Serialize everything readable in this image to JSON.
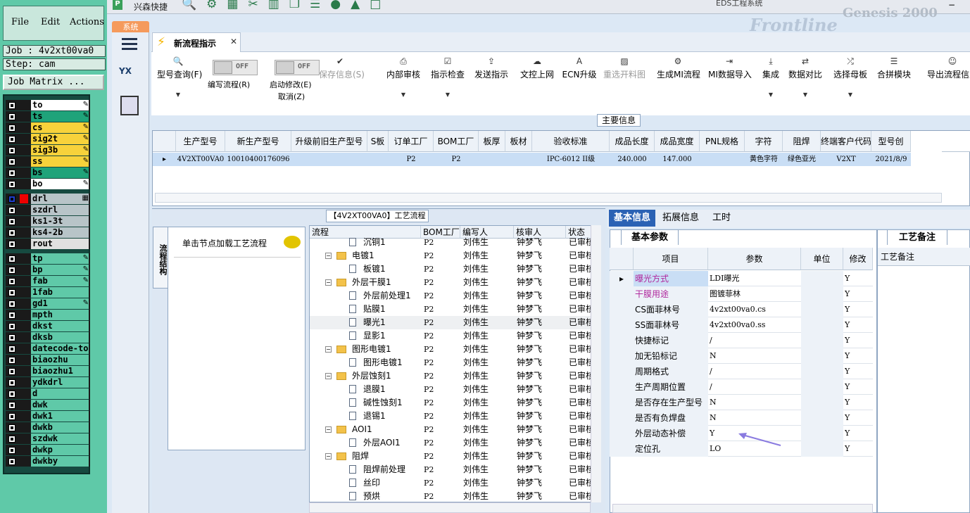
{
  "genesis": {
    "menu": {
      "file": "File",
      "edit": "Edit",
      "actions": "Actions"
    },
    "job": "Job : 4v2xt00va0",
    "step": "Step: cam",
    "job_matrix": "Job Matrix ...",
    "layers": [
      {
        "name": "to",
        "color": "#ffffff",
        "icon": "edit-icon"
      },
      {
        "name": "ts",
        "color": "#1fa37a",
        "icon": "edit-icon"
      },
      {
        "name": "cs",
        "color": "#f7d23b",
        "icon": "edit-icon"
      },
      {
        "name": "sig2t",
        "color": "#f7d23b",
        "icon": "edit-icon"
      },
      {
        "name": "sig3b",
        "color": "#f7d23b",
        "icon": "edit-icon"
      },
      {
        "name": "ss",
        "color": "#f7d23b",
        "icon": "edit-icon"
      },
      {
        "name": "bs",
        "color": "#1fa37a",
        "icon": "edit-icon"
      },
      {
        "name": "bo",
        "color": "#ffffff",
        "icon": "edit-icon"
      },
      {
        "name": "drl",
        "color": "#b8c4c8",
        "icon": "grid-icon"
      },
      {
        "name": "szdrl",
        "color": "#b8c4c8",
        "icon": ""
      },
      {
        "name": "ks1-3t",
        "color": "#b8c4c8",
        "icon": ""
      },
      {
        "name": "ks4-2b",
        "color": "#b8c4c8",
        "icon": ""
      },
      {
        "name": "rout",
        "color": "#e0e0e0",
        "icon": ""
      },
      {
        "name": "tp",
        "color": "#5fc9a8",
        "icon": "edit-icon"
      },
      {
        "name": "bp",
        "color": "#5fc9a8",
        "icon": "edit-icon"
      },
      {
        "name": "fab",
        "color": "#5fc9a8",
        "icon": "edit-icon"
      },
      {
        "name": "1fab",
        "color": "#5fc9a8",
        "icon": ""
      },
      {
        "name": "gd1",
        "color": "#5fc9a8",
        "icon": "edit-icon"
      },
      {
        "name": "mpth",
        "color": "#5fc9a8",
        "icon": ""
      },
      {
        "name": "dkst",
        "color": "#5fc9a8",
        "icon": ""
      },
      {
        "name": "dksb",
        "color": "#5fc9a8",
        "icon": ""
      },
      {
        "name": "datecode-to",
        "color": "#5fc9a8",
        "icon": ""
      },
      {
        "name": "biaozhu",
        "color": "#5fc9a8",
        "icon": ""
      },
      {
        "name": "biaozhu1",
        "color": "#5fc9a8",
        "icon": ""
      },
      {
        "name": "ydkdrl",
        "color": "#5fc9a8",
        "icon": ""
      },
      {
        "name": "d",
        "color": "#5fc9a8",
        "icon": ""
      },
      {
        "name": "dwk",
        "color": "#5fc9a8",
        "icon": ""
      },
      {
        "name": "dwk1",
        "color": "#5fc9a8",
        "icon": ""
      },
      {
        "name": "dwkb",
        "color": "#5fc9a8",
        "icon": ""
      },
      {
        "name": "szdwk",
        "color": "#5fc9a8",
        "icon": ""
      },
      {
        "name": "dwkp",
        "color": "#5fc9a8",
        "icon": ""
      },
      {
        "name": "dwkby",
        "color": "#5fc9a8",
        "icon": ""
      }
    ]
  },
  "app": {
    "window_title": "EDS工程系统",
    "quick_label": "兴森快捷",
    "system_tab": "系统",
    "genesis_bg": "Genesis 2000",
    "frontline": "Frontline",
    "doc_tab": "新流程指示",
    "yx_label": "YX"
  },
  "toolbar": {
    "items": [
      {
        "label": "型号查询(F)",
        "icon": "search-icon",
        "dropdown": true,
        "disabled": false
      },
      {
        "label": "保存信息(S)",
        "icon": "check-icon",
        "dropdown": false,
        "disabled": true
      },
      {
        "label": "内部审核",
        "icon": "print-icon",
        "dropdown": true,
        "disabled": false
      },
      {
        "label": "指示检查",
        "icon": "checkbox-icon",
        "dropdown": true,
        "disabled": false
      },
      {
        "label": "发送指示",
        "icon": "upload-icon",
        "dropdown": false,
        "disabled": false
      },
      {
        "label": "文控上网",
        "icon": "cloud-upload-icon",
        "dropdown": false,
        "disabled": false
      },
      {
        "label": "ECN升级",
        "icon": "ecn-icon",
        "dropdown": false,
        "disabled": false
      },
      {
        "label": "重选开料图",
        "icon": "image-icon",
        "dropdown": false,
        "disabled": true
      },
      {
        "label": "生成MI流程",
        "icon": "gears-icon",
        "dropdown": false,
        "disabled": false
      },
      {
        "label": "MI数据导入",
        "icon": "import-icon",
        "dropdown": false,
        "disabled": false
      },
      {
        "label": "集成",
        "icon": "download-icon",
        "dropdown": true,
        "disabled": false
      },
      {
        "label": "数据对比",
        "icon": "compare-icon",
        "dropdown": true,
        "disabled": false
      },
      {
        "label": "选择母板",
        "icon": "shuffle-icon",
        "dropdown": true,
        "disabled": false
      },
      {
        "label": "合拼模块",
        "icon": "list-icon",
        "dropdown": false,
        "disabled": false
      },
      {
        "label": "导出流程信息",
        "icon": "smile-icon",
        "dropdown": false,
        "disabled": false
      }
    ],
    "toggle1": {
      "state": "OFF",
      "label": "编写流程(R)"
    },
    "toggle2": {
      "state": "OFF",
      "label1": "启动修改(E)",
      "label2": "取消(Z)"
    }
  },
  "main_info": {
    "title": "主要信息",
    "columns": [
      "生产型号",
      "新生产型号",
      "升级前旧生产型号",
      "S板",
      "订单工厂",
      "BOM工厂",
      "板厚",
      "板材",
      "验收标准",
      "成品长度",
      "成品宽度",
      "PNL规格",
      "字符",
      "阻焊",
      "终端客户代码",
      "型号创"
    ],
    "row": [
      "4V2XT00VA0",
      "10010400176096",
      "",
      "",
      "P2",
      "P2",
      "",
      "",
      "IPC-6012 II级",
      "240.000",
      "147.000",
      "",
      "黄色字符",
      "绿色亚光",
      "V2XT",
      "2021/8/9"
    ]
  },
  "workflow": {
    "title": "【4V2XT00VA0】工艺流程",
    "side_tab": "流程结构",
    "hint": "单击节点加载工艺流程",
    "columns": [
      "流程",
      "BOM工厂",
      "编写人",
      "核审人",
      "状态"
    ],
    "rows": [
      {
        "name": "沉铜1",
        "level": 1,
        "folder": false,
        "bom": "P2",
        "writer": "刘伟生",
        "reviewer": "钟梦飞",
        "status": "已审核"
      },
      {
        "name": "电镀1",
        "level": 0,
        "folder": true,
        "bom": "P2",
        "writer": "刘伟生",
        "reviewer": "钟梦飞",
        "status": "已审核"
      },
      {
        "name": "板镀1",
        "level": 1,
        "folder": false,
        "bom": "P2",
        "writer": "刘伟生",
        "reviewer": "钟梦飞",
        "status": "已审核"
      },
      {
        "name": "外层干膜1",
        "level": 0,
        "folder": true,
        "bom": "P2",
        "writer": "刘伟生",
        "reviewer": "钟梦飞",
        "status": "已审核"
      },
      {
        "name": "外层前处理1",
        "level": 1,
        "folder": false,
        "bom": "P2",
        "writer": "刘伟生",
        "reviewer": "钟梦飞",
        "status": "已审核"
      },
      {
        "name": "贴膜1",
        "level": 1,
        "folder": false,
        "bom": "P2",
        "writer": "刘伟生",
        "reviewer": "钟梦飞",
        "status": "已审核"
      },
      {
        "name": "曝光1",
        "level": 1,
        "folder": false,
        "bom": "P2",
        "writer": "刘伟生",
        "reviewer": "钟梦飞",
        "status": "已审核",
        "selected": true
      },
      {
        "name": "显影1",
        "level": 1,
        "folder": false,
        "bom": "P2",
        "writer": "刘伟生",
        "reviewer": "钟梦飞",
        "status": "已审核"
      },
      {
        "name": "图形电镀1",
        "level": 0,
        "folder": true,
        "bom": "P2",
        "writer": "刘伟生",
        "reviewer": "钟梦飞",
        "status": "已审核"
      },
      {
        "name": "图形电镀1",
        "level": 1,
        "folder": false,
        "bom": "P2",
        "writer": "刘伟生",
        "reviewer": "钟梦飞",
        "status": "已审核"
      },
      {
        "name": "外层蚀刻1",
        "level": 0,
        "folder": true,
        "bom": "P2",
        "writer": "刘伟生",
        "reviewer": "钟梦飞",
        "status": "已审核"
      },
      {
        "name": "退膜1",
        "level": 1,
        "folder": false,
        "bom": "P2",
        "writer": "刘伟生",
        "reviewer": "钟梦飞",
        "status": "已审核"
      },
      {
        "name": "碱性蚀刻1",
        "level": 1,
        "folder": false,
        "bom": "P2",
        "writer": "刘伟生",
        "reviewer": "钟梦飞",
        "status": "已审核"
      },
      {
        "name": "退锡1",
        "level": 1,
        "folder": false,
        "bom": "P2",
        "writer": "刘伟生",
        "reviewer": "钟梦飞",
        "status": "已审核"
      },
      {
        "name": "AOI1",
        "level": 0,
        "folder": true,
        "bom": "P2",
        "writer": "刘伟生",
        "reviewer": "钟梦飞",
        "status": "已审核"
      },
      {
        "name": "外层AOI1",
        "level": 1,
        "folder": false,
        "bom": "P2",
        "writer": "刘伟生",
        "reviewer": "钟梦飞",
        "status": "已审核"
      },
      {
        "name": "阻焊",
        "level": 0,
        "folder": true,
        "bom": "P2",
        "writer": "刘伟生",
        "reviewer": "钟梦飞",
        "status": "已审核"
      },
      {
        "name": "阻焊前处理",
        "level": 1,
        "folder": false,
        "bom": "P2",
        "writer": "刘伟生",
        "reviewer": "钟梦飞",
        "status": "已审核"
      },
      {
        "name": "丝印",
        "level": 1,
        "folder": false,
        "bom": "P2",
        "writer": "刘伟生",
        "reviewer": "钟梦飞",
        "status": "已审核"
      },
      {
        "name": "预烘",
        "level": 1,
        "folder": false,
        "bom": "P2",
        "writer": "刘伟生",
        "reviewer": "钟梦飞",
        "status": "已审核"
      }
    ]
  },
  "right": {
    "tabs": [
      "基本信息",
      "拓展信息",
      "工时"
    ],
    "base_tab": "基本参数",
    "columns": [
      "项目",
      "参数",
      "单位",
      "修改"
    ],
    "rows": [
      {
        "item": "曝光方式",
        "value": "LDI曝光",
        "unit": "",
        "mod": "Y",
        "highlight": true,
        "current": true
      },
      {
        "item": "干膜用途",
        "value": "图镀菲林",
        "unit": "",
        "mod": "Y",
        "highlight": true
      },
      {
        "item": "CS面菲林号",
        "value": "4v2xt00va0.cs",
        "unit": "",
        "mod": "Y"
      },
      {
        "item": "SS面菲林号",
        "value": "4v2xt00va0.ss",
        "unit": "",
        "mod": "Y"
      },
      {
        "item": "快捷标记",
        "value": "/",
        "unit": "",
        "mod": "Y"
      },
      {
        "item": "加无铅标记",
        "value": "N",
        "unit": "",
        "mod": "Y"
      },
      {
        "item": "周期格式",
        "value": "/",
        "unit": "",
        "mod": "Y"
      },
      {
        "item": "生产周期位置",
        "value": "/",
        "unit": "",
        "mod": "Y"
      },
      {
        "item": "是否存在生产型号",
        "value": "N",
        "unit": "",
        "mod": "Y"
      },
      {
        "item": "是否有负焊盘",
        "value": "N",
        "unit": "",
        "mod": "Y"
      },
      {
        "item": "外层动态补偿",
        "value": "Y",
        "unit": "",
        "mod": "Y"
      },
      {
        "item": "定位孔",
        "value": "LO",
        "unit": "",
        "mod": "Y"
      }
    ],
    "remark_tab": "工艺备注",
    "remark_header": "工艺备注"
  },
  "colors": {
    "highlight_text": "#b0279d",
    "selected_row": "#c9def5",
    "arrow": "#8a7be0"
  }
}
